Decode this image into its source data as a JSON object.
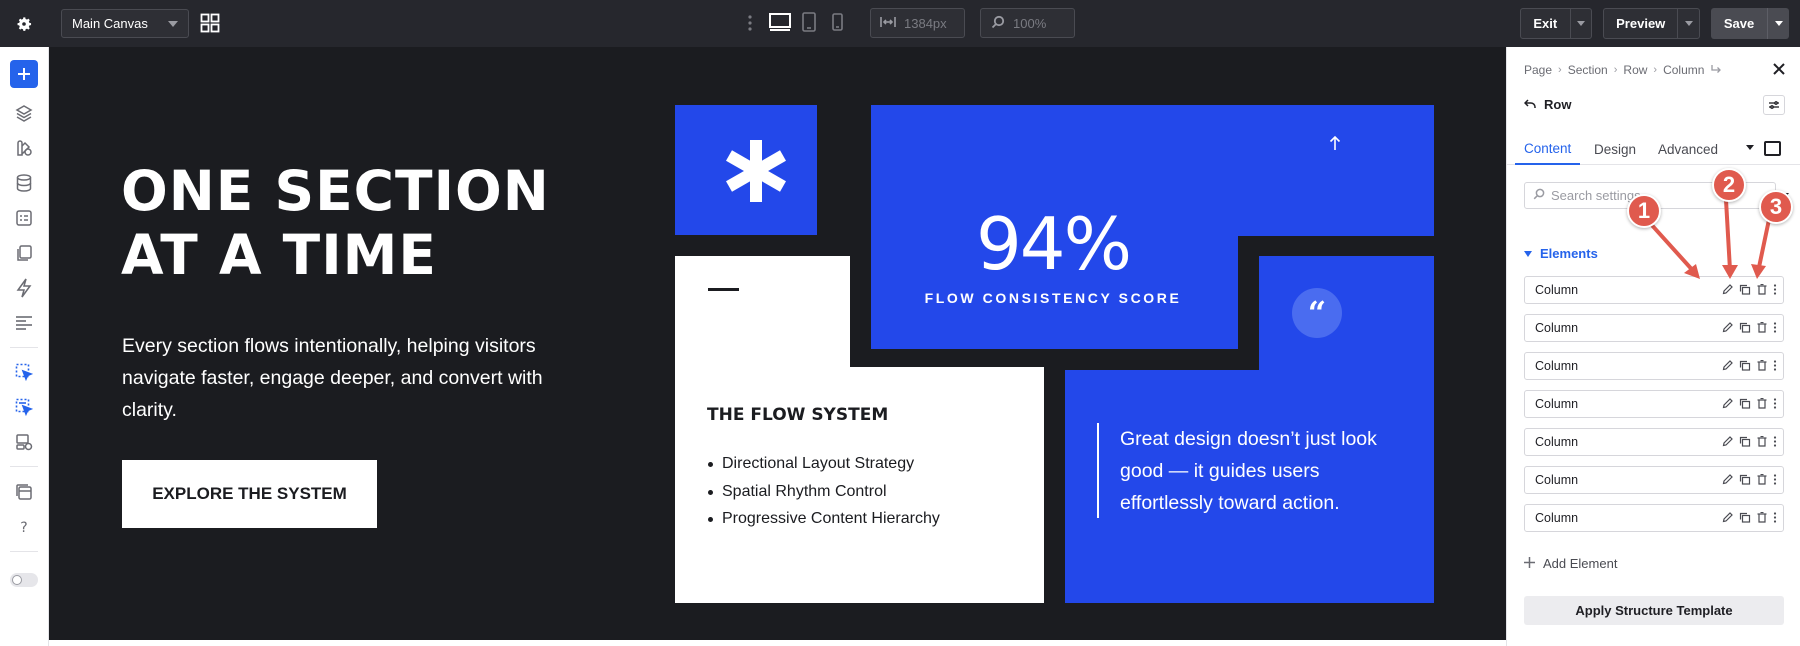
{
  "topbar": {
    "canvas_name": "Main Canvas",
    "width_value": "1384px",
    "zoom_value": "100%",
    "exit_label": "Exit",
    "preview_label": "Preview",
    "save_label": "Save"
  },
  "hero": {
    "title": "ONE SECTION AT A TIME",
    "description": "Every section flows intentionally, helping visitors navigate faster, engage deeper, and convert with clarity.",
    "cta_label": "EXPLORE THE SYSTEM"
  },
  "stat": {
    "value": "94%",
    "label": "FLOW CONSISTENCY SCORE"
  },
  "flow": {
    "title": "THE FLOW SYSTEM",
    "items": [
      "Directional Layout Strategy",
      "Spatial Rhythm Control",
      "Progressive Content Hierarchy"
    ]
  },
  "quote": {
    "mark": "“",
    "text": "Great design doesn’t just look good — it guides users effortlessly toward action."
  },
  "panel": {
    "breadcrumbs": [
      "Page",
      "Section",
      "Row",
      "Column"
    ],
    "header": "Row",
    "tabs": [
      "Content",
      "Design",
      "Advanced"
    ],
    "search_placeholder": "Search settings",
    "section_title": "Elements",
    "elements": [
      "Column",
      "Column",
      "Column",
      "Column",
      "Column",
      "Column",
      "Column"
    ],
    "add_element_label": "Add Element",
    "apply_label": "Apply Structure Template"
  },
  "annotations": [
    "1",
    "2",
    "3"
  ],
  "colors": {
    "accent": "#2563eb",
    "brand_blue": "#2348ea",
    "canvas_bg": "#1b1c20",
    "topbar_bg": "#26272d",
    "annotation": "#e05a4e"
  }
}
